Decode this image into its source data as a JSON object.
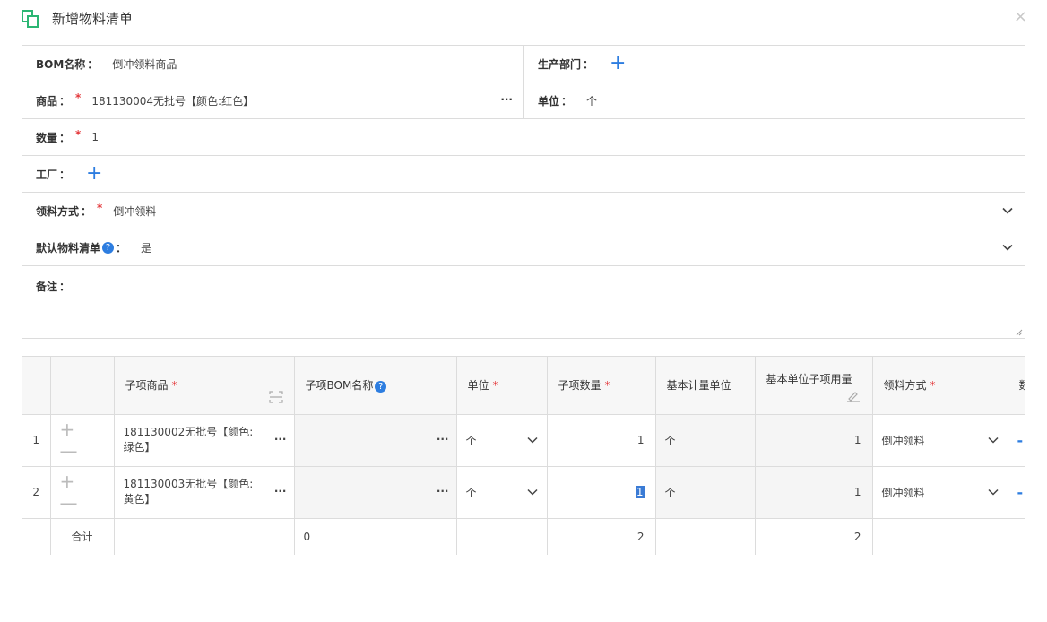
{
  "dialog": {
    "title": "新增物料清单",
    "close": "×"
  },
  "form": {
    "bom_name": {
      "label": "BOM名称",
      "value": "倒冲领料商品"
    },
    "dept": {
      "label": "生产部门"
    },
    "product": {
      "label": "商品",
      "value": "181130004无批号【颜色:红色】",
      "more": "···"
    },
    "unit": {
      "label": "单位",
      "value": "个"
    },
    "qty": {
      "label": "数量",
      "value": "1"
    },
    "factory": {
      "label": "工厂"
    },
    "pick_method": {
      "label": "领料方式",
      "value": "倒冲领料"
    },
    "default_bom": {
      "label": "默认物料清单",
      "help": "?",
      "value": "是"
    },
    "remark": {
      "label": "备注",
      "value": ""
    },
    "colon": "：",
    "required": "*",
    "plus": "+"
  },
  "grid": {
    "headers": {
      "item": "子项商品",
      "bom": "子项BOM名称",
      "unit": "单位",
      "qty": "子项数量",
      "base_unit": "基本计量单位",
      "base_qty": "基本单位子项用量",
      "method": "领料方式",
      "extra": "数"
    },
    "rows": [
      {
        "index": "1",
        "item": "181130002无批号【颜色:绿色】",
        "unit": "个",
        "qty": "1",
        "base_unit": "个",
        "base_qty": "1",
        "method": "倒冲领料"
      },
      {
        "index": "2",
        "item": "181130003无批号【颜色:黄色】",
        "unit": "个",
        "qty": "1",
        "base_unit": "个",
        "base_qty": "1",
        "method": "倒冲领料"
      }
    ],
    "summary": {
      "label": "合计",
      "bom": "0",
      "qty": "2",
      "base_qty": "2"
    },
    "add": "+",
    "remove": "—",
    "more": "···",
    "dash": "-"
  },
  "colors": {
    "accent": "#2d7de0",
    "required": "#e4393c",
    "logo": "#2bb673"
  },
  "icons": [
    "dialog-logo-icon",
    "close-icon",
    "chevron-down-icon",
    "help-icon",
    "column-settings-icon",
    "batch-edit-icon"
  ]
}
